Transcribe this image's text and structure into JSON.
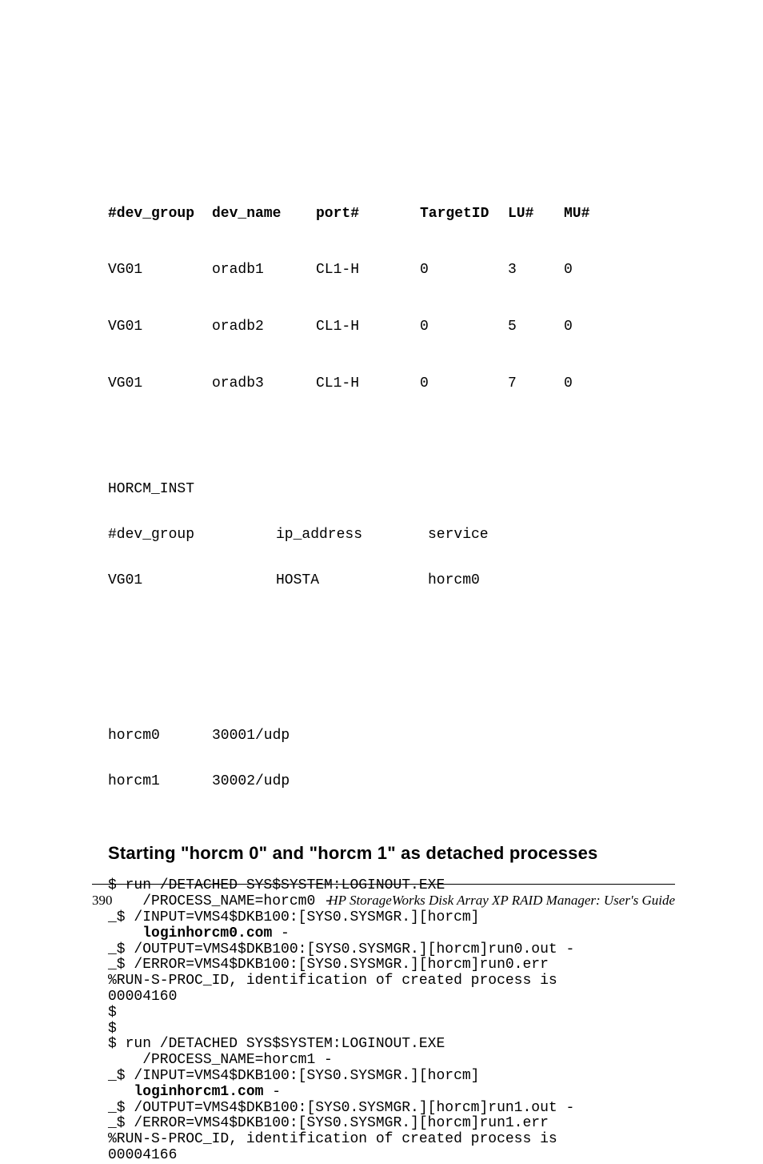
{
  "device_table": {
    "headers": {
      "dev_group": "#dev_group",
      "dev_name": "dev_name",
      "port": "port#",
      "target_id": "TargetID",
      "lu": "LU#",
      "mu": "MU#"
    },
    "rows": [
      {
        "dev_group": "VG01",
        "dev_name": "oradb1",
        "port": "CL1-H",
        "target_id": "0",
        "lu": "3",
        "mu": "0"
      },
      {
        "dev_group": "VG01",
        "dev_name": "oradb2",
        "port": "CL1-H",
        "target_id": "0",
        "lu": "5",
        "mu": "0"
      },
      {
        "dev_group": "VG01",
        "dev_name": "oradb3",
        "port": "CL1-H",
        "target_id": "0",
        "lu": "7",
        "mu": "0"
      }
    ]
  },
  "horcm_inst": {
    "title": "HORCM_INST",
    "headers": {
      "dev_group": "#dev_group",
      "ip_address": "ip_address",
      "service": "service"
    },
    "rows": [
      {
        "dev_group": "VG01",
        "ip_address": "HOSTA",
        "service": "horcm0"
      }
    ]
  },
  "port_listing": [
    {
      "name": "horcm0",
      "port": "30001/udp"
    },
    {
      "name": "horcm1",
      "port": "30002/udp"
    }
  ],
  "section_heading": "Starting  \"horcm 0\" and \"horcm 1\" as detached processes",
  "code": {
    "l01": "$ run /DETACHED SYS$SYSTEM:LOGINOUT.EXE",
    "l02": "    /PROCESS_NAME=horcm0 -",
    "l03": "_$ /INPUT=VMS4$DKB100:[SYS0.SYSMGR.][horcm]",
    "l04a": "    ",
    "l04b": "loginhorcm0.com",
    "l04c": " -",
    "l05": "_$ /OUTPUT=VMS4$DKB100:[SYS0.SYSMGR.][horcm]run0.out -",
    "l06": "_$ /ERROR=VMS4$DKB100:[SYS0.SYSMGR.][horcm]run0.err",
    "l07": "%RUN-S-PROC_ID, identification of created process is",
    "l08": "00004160",
    "l09": "$",
    "l10": "$",
    "l11": "$ run /DETACHED SYS$SYSTEM:LOGINOUT.EXE",
    "l12": "    /PROCESS_NAME=horcm1 -",
    "l13": "_$ /INPUT=VMS4$DKB100:[SYS0.SYSMGR.][horcm]",
    "l14a": "   ",
    "l14b": "loginhorcm1.com",
    "l14c": " -",
    "l15": "_$ /OUTPUT=VMS4$DKB100:[SYS0.SYSMGR.][horcm]run1.out -",
    "l16": "_$ /ERROR=VMS4$DKB100:[SYS0.SYSMGR.][horcm]run1.err",
    "l17": "%RUN-S-PROC_ID, identification of created process is",
    "l18": "00004166"
  },
  "footer": {
    "page_number": "390",
    "doc_title": "HP StorageWorks Disk Array XP RAID Manager: User's Guide"
  }
}
